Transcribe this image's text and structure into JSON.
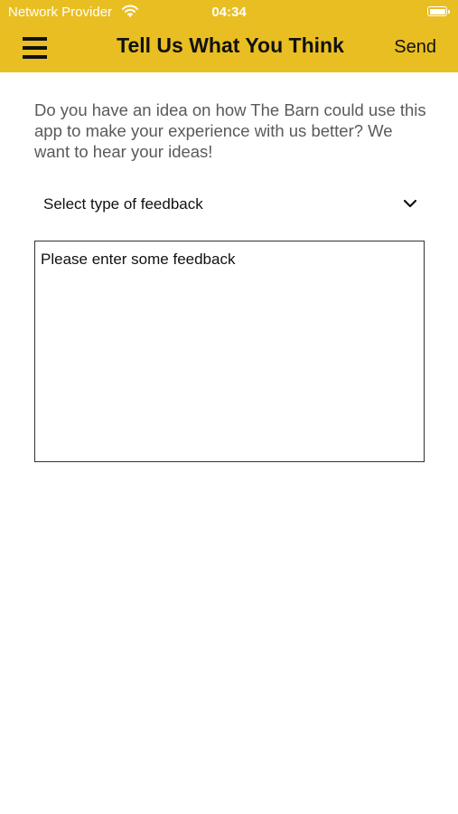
{
  "status_bar": {
    "carrier": "Network Provider",
    "time": "04:34",
    "wifi_icon": "wifi-icon",
    "battery_icon": "battery-icon"
  },
  "nav": {
    "menu_icon": "hamburger-menu-icon",
    "title": "Tell Us What You Think",
    "send_label": "Send"
  },
  "main": {
    "intro_text": "Do you have an idea on how The Barn could use this app to make your experience with us better? We want to hear your ideas!",
    "feedback_type": {
      "selected": "Select type of feedback",
      "icon": "chevron-down-icon"
    },
    "feedback": {
      "value": "",
      "placeholder": "Please enter some feedback"
    }
  },
  "colors": {
    "header_background": "#E9BE22",
    "text_primary": "#111111",
    "text_secondary": "#5a5a5a",
    "background": "#ffffff"
  }
}
